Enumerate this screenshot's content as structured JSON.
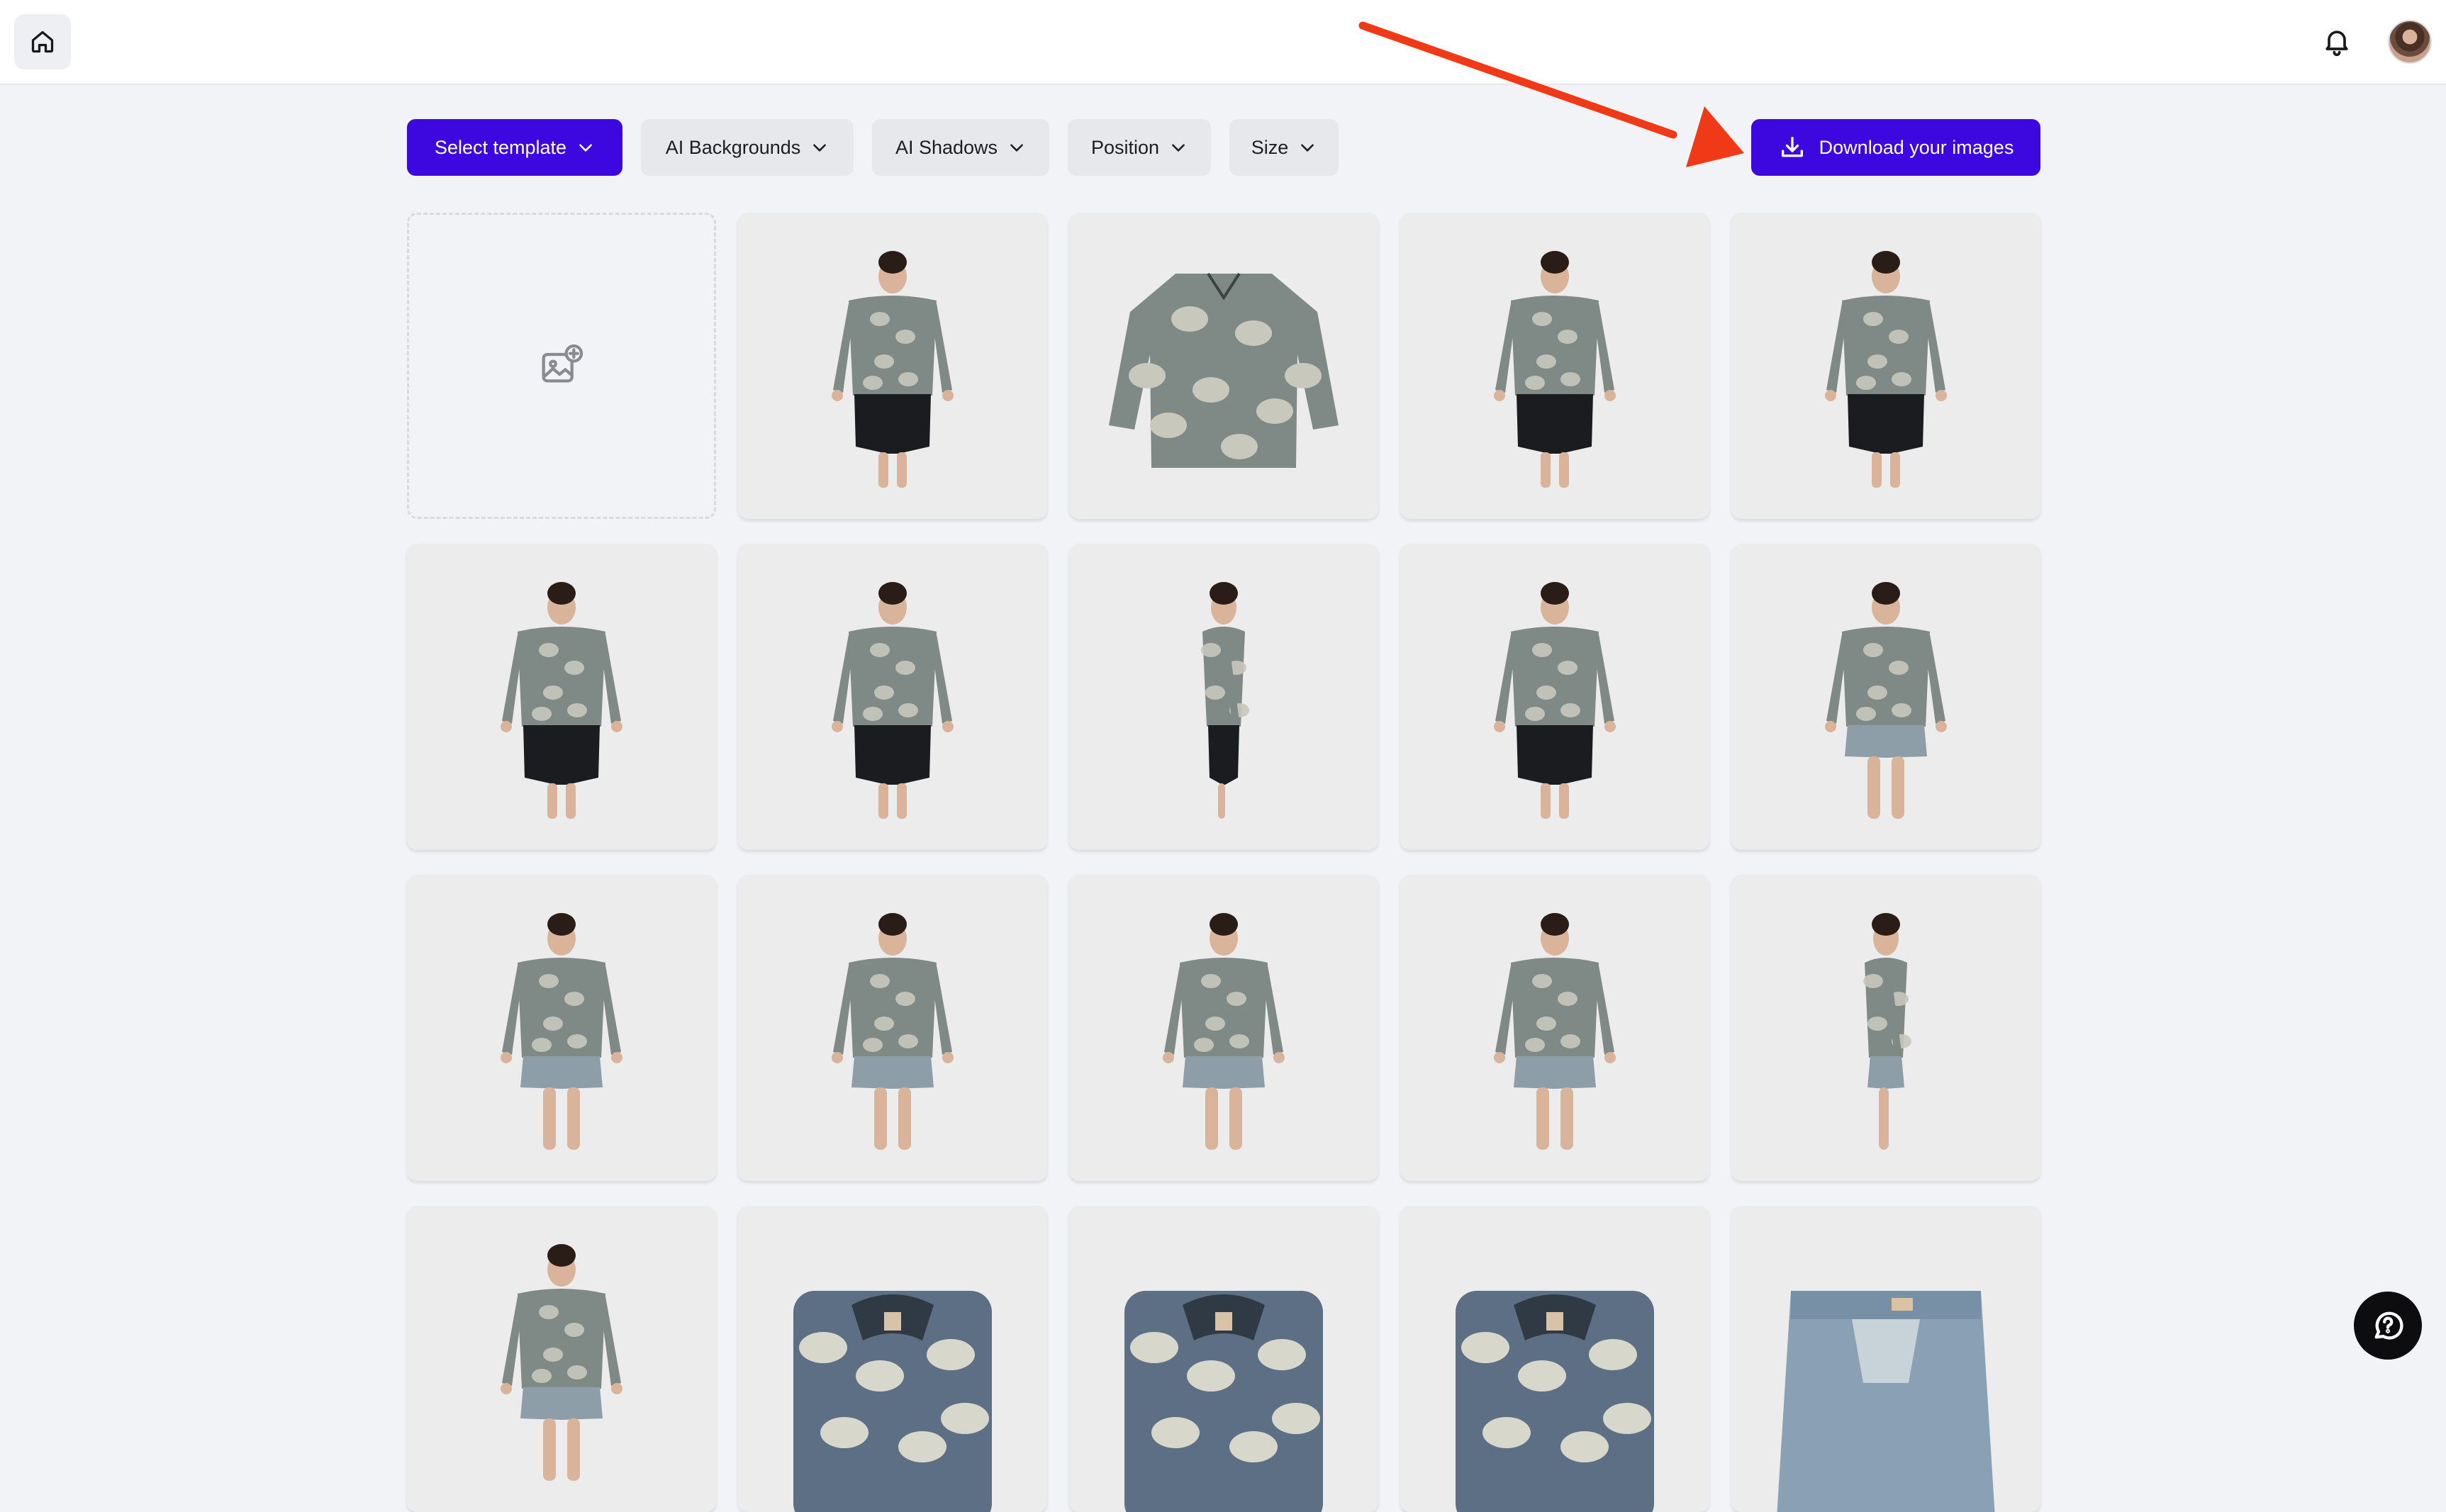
{
  "header": {
    "home_icon": "home-icon",
    "bell_icon": "bell-icon",
    "avatar": "user-avatar"
  },
  "toolbar": {
    "select_template": "Select template",
    "ai_backgrounds": "AI Backgrounds",
    "ai_shadows": "AI Shadows",
    "position": "Position",
    "size": "Size",
    "download": "Download your images",
    "accent_color": "#3d08e0"
  },
  "grid": {
    "upload_icon": "add-image-icon",
    "images": [
      "model-front-shirt-leggings",
      "shirt-flat-lay",
      "model-front-shirt-leggings",
      "model-back-shirt-leggings",
      "model-back-shirt-leggings",
      "model-front-shirt-leggings",
      "model-side-shirt-leggings",
      "model-walking-shirt-leggings",
      "model-front-shirt-shorts",
      "model-front-shirt-shorts",
      "model-front-shirt-shorts",
      "model-back-shirt-shorts",
      "model-front-lifted-shirt-shorts",
      "model-side-shirt-shorts",
      "model-back-shirt-jeans",
      "shirt-collar-detail",
      "shirt-collar-detail",
      "shirt-collar-detail",
      "jeans-waistband-detail"
    ]
  },
  "help": {
    "icon": "help-icon"
  },
  "annotation": {
    "arrow_color": "#f03a17"
  }
}
